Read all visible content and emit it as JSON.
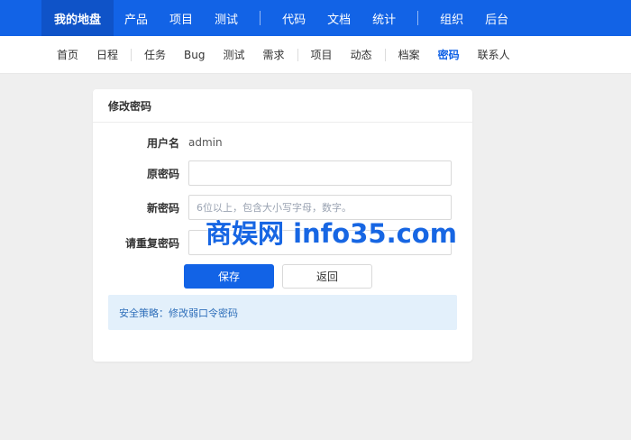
{
  "topnav": {
    "items": [
      "我的地盘",
      "产品",
      "项目",
      "测试",
      "代码",
      "文档",
      "统计",
      "组织",
      "后台"
    ]
  },
  "subnav": {
    "items": [
      "首页",
      "日程",
      "任务",
      "Bug",
      "测试",
      "需求",
      "项目",
      "动态",
      "档案",
      "密码",
      "联系人"
    ]
  },
  "panel": {
    "title": "修改密码",
    "username_label": "用户名",
    "username_value": "admin",
    "old_password_label": "原密码",
    "new_password_label": "新密码",
    "new_password_placeholder": "6位以上，包含大小写字母，数字。",
    "repeat_password_label": "请重复密码",
    "save_label": "保存",
    "back_label": "返回",
    "policy_text": "安全策略：修改弱口令密码"
  },
  "watermark": "商娱网 info35.com",
  "colors": {
    "brand": "#1263e6",
    "active_tab": "#1263e6",
    "policy_bg": "#e3f0fb"
  }
}
